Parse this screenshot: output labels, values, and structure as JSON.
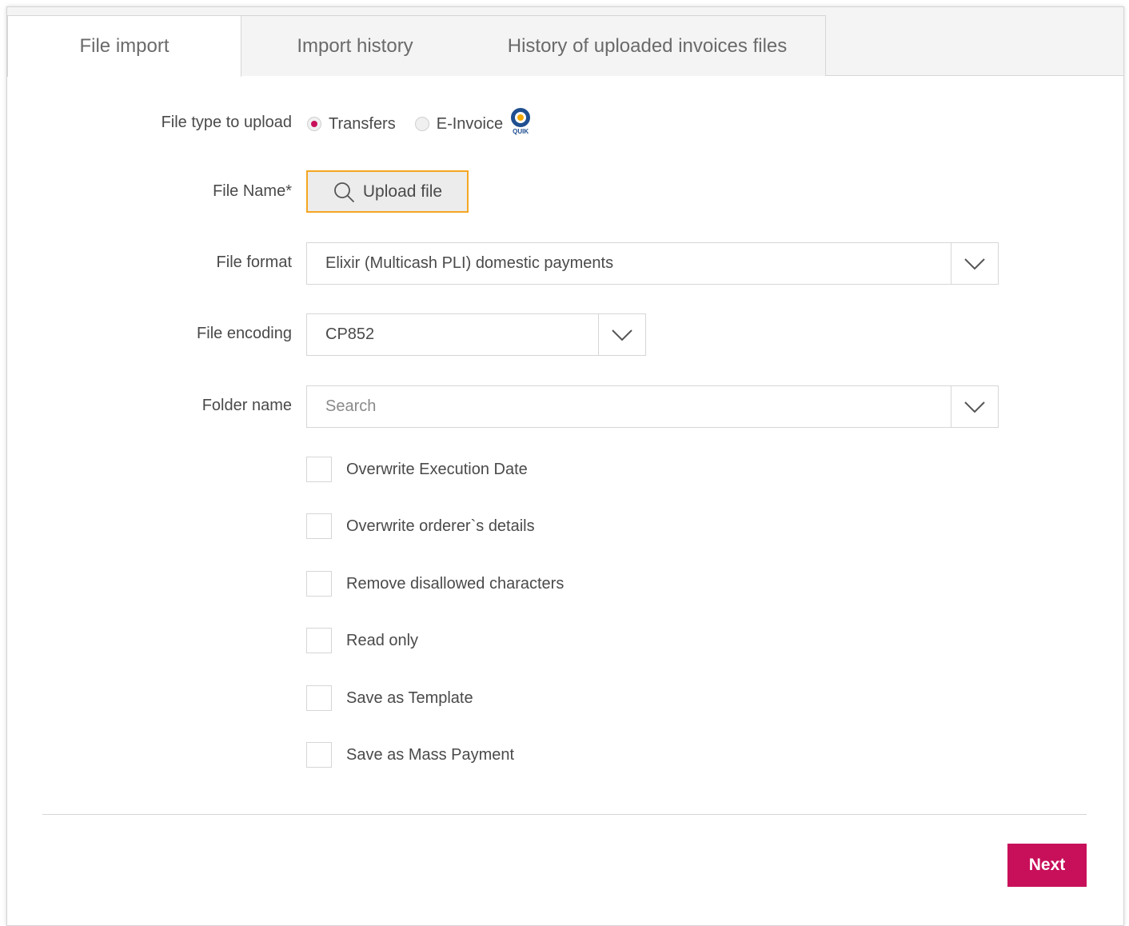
{
  "tabs": [
    {
      "label": "File import"
    },
    {
      "label": "Import history"
    },
    {
      "label": "History of uploaded invoices files"
    }
  ],
  "form": {
    "file_type": {
      "label": "File type to upload",
      "options": [
        {
          "label": "Transfers",
          "selected": true
        },
        {
          "label": "E-Invoice",
          "selected": false
        }
      ],
      "badge_text": "QUIK"
    },
    "file_name": {
      "label": "File Name*",
      "button_label": "Upload file"
    },
    "file_format": {
      "label": "File format",
      "value": "Elixir (Multicash PLI) domestic payments"
    },
    "file_encoding": {
      "label": "File encoding",
      "value": "CP852"
    },
    "folder_name": {
      "label": "Folder name",
      "placeholder": "Search"
    },
    "checkboxes": [
      {
        "label": "Overwrite Execution Date",
        "checked": false
      },
      {
        "label": "Overwrite orderer`s details",
        "checked": false
      },
      {
        "label": "Remove disallowed characters",
        "checked": false
      },
      {
        "label": "Read only",
        "checked": false
      },
      {
        "label": "Save as Template",
        "checked": false
      },
      {
        "label": "Save as Mass Payment",
        "checked": false
      }
    ]
  },
  "actions": {
    "next_label": "Next"
  },
  "colors": {
    "accent": "#c8105a",
    "focus_border": "#f5a623",
    "quik_blue": "#1f4f8f",
    "quik_yellow": "#f2a900"
  }
}
